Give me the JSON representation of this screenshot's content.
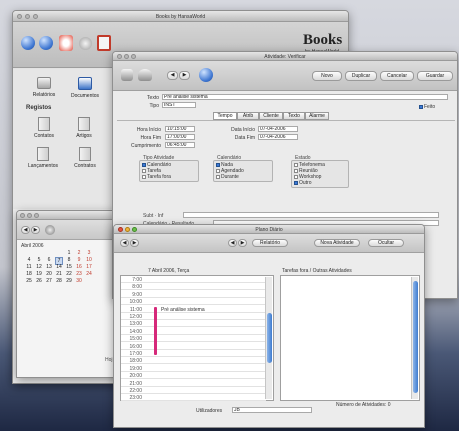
{
  "main_window": {
    "title": "Books by HansaWorld",
    "brand_title": "Books",
    "brand_sub": "by HansaWorld"
  },
  "sidebar": {
    "items": [
      {
        "label": "Relatórios",
        "icon": "reports-icon"
      },
      {
        "label": "Documentos",
        "icon": "documents-icon"
      }
    ],
    "section_label": "Registos",
    "registers": [
      {
        "label": "Contatos"
      },
      {
        "label": "Artigos"
      },
      {
        "label": "Lançamentos"
      },
      {
        "label": "Contratos"
      }
    ]
  },
  "calendar": {
    "month": "Abril 2006",
    "weeks": [
      [
        "",
        "",
        "",
        "",
        "1",
        "2",
        "3"
      ],
      [
        "4",
        "5",
        "6",
        "7",
        "8",
        "9",
        "10"
      ],
      [
        "11",
        "12",
        "13",
        "14",
        "15",
        "16",
        "17"
      ],
      [
        "18",
        "19",
        "20",
        "21",
        "22",
        "23",
        "24"
      ],
      [
        "25",
        "26",
        "27",
        "28",
        "29",
        "30",
        ""
      ]
    ],
    "footer": "Hoj"
  },
  "activity": {
    "title": "Atividade: Verificar",
    "buttons": [
      "Novo",
      "Duplicar",
      "Cancelar",
      "Guardar"
    ],
    "texto_label": "Texto",
    "texto_value": "Pré análise sistema",
    "tipo_label": "Tipo",
    "tipo_value": "INST",
    "feito_label": "Feito",
    "tabs": [
      "Tempo",
      "Atrib",
      "Cliente",
      "Texto",
      "Alarme"
    ],
    "hora_inicio_label": "Hora Início",
    "hora_inicio": "10:15:00",
    "hora_fim_label": "Hora Fim",
    "hora_fim": "17:00:00",
    "cumprimento_label": "Cumprimento",
    "cumprimento": "06:45:00",
    "data_inicio_label": "Data Início",
    "data_inicio": "07-04-2006",
    "data_fim_label": "Data Fim",
    "data_fim": "07-04-2006",
    "tipo_atividade_label": "Tipo Atividade",
    "tipo_atividade": [
      "Calendário",
      "Tarefa",
      "Tarefa fora"
    ],
    "calendario_label": "Calendário",
    "calendario": [
      "Nada",
      "Agendado",
      "Durante"
    ],
    "estado_label": "Estado",
    "estado": [
      "Telefonema",
      "Reunião",
      "Workshop",
      "Outro"
    ],
    "rodape_a": "Subt · Inf",
    "rodape_b": "Calendário · Resultado"
  },
  "planner": {
    "title": "Plano Diário",
    "buttons": [
      "Relatório",
      "Nova Atividade",
      "Ocultar"
    ],
    "date_header": "7 Abril 2006, Terça",
    "right_header": "Tarefas fora / Outras Atividades",
    "event_text": "Pré análise sistema",
    "times": [
      "7:00",
      "8:00",
      "9:00",
      "10:00",
      "11:00",
      "12:00",
      "13:00",
      "14:00",
      "15:00",
      "16:00",
      "17:00",
      "18:00",
      "19:00",
      "20:00",
      "21:00",
      "22:00",
      "23:00"
    ],
    "users_label": "Utilizadores",
    "users_value": "JB",
    "activities_count_label": "Número de Atividades: 0",
    "event_color": "#d6297a"
  }
}
